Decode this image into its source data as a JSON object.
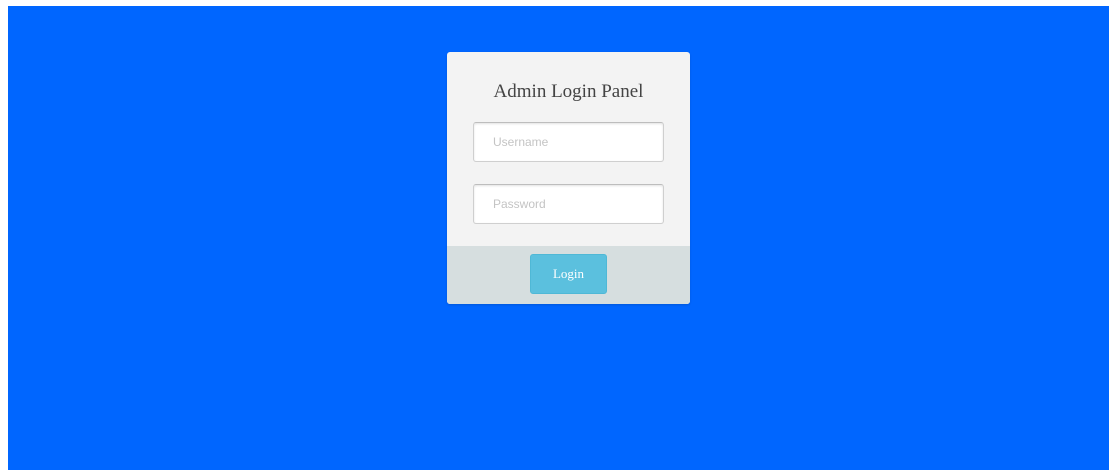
{
  "colors": {
    "page_background": "#0066ff",
    "panel_background": "#f3f3f3",
    "footer_background": "#d6dedf",
    "button_background": "#5bc0de"
  },
  "login_panel": {
    "title": "Admin Login Panel",
    "username": {
      "placeholder": "Username",
      "value": ""
    },
    "password": {
      "placeholder": "Password",
      "value": ""
    },
    "login_button_label": "Login"
  }
}
